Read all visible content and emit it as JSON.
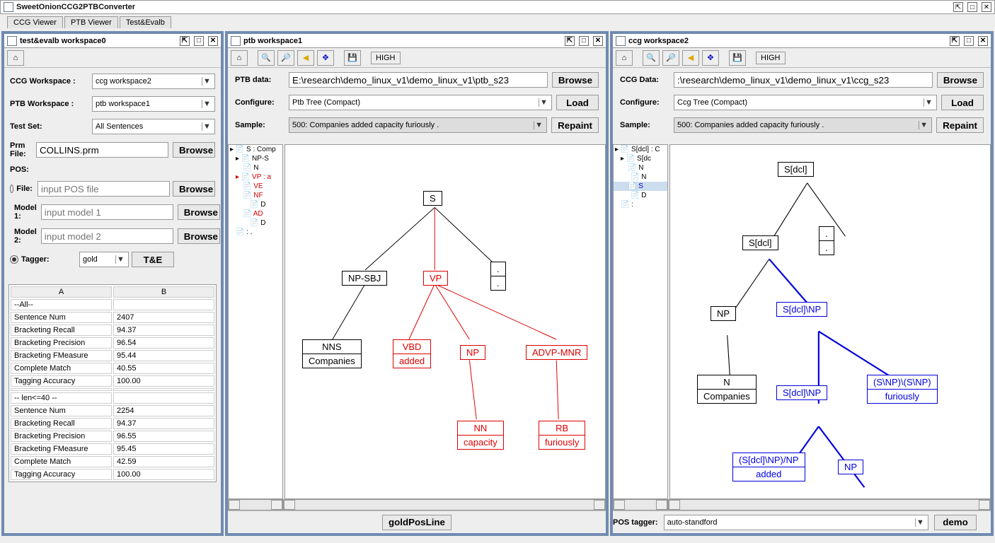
{
  "app": {
    "title": "SweetOnionCCG2PTBConverter",
    "tabs": [
      "CCG Viewer",
      "PTB Viewer",
      "Test&Evalb"
    ]
  },
  "left": {
    "title": "test&evalb workspace0",
    "ccg_ws_label": "CCG Workspace :",
    "ccg_ws_value": "ccg workspace2",
    "ptb_ws_label": "PTB Workspace :",
    "ptb_ws_value": "ptb workspace1",
    "testset_label": "Test Set:",
    "testset_value": "All Sentences",
    "prm_label": "Prm File:",
    "prm_value": "COLLINS.prm",
    "browse": "Browse",
    "pos_label": "POS:",
    "file_label": "File:",
    "file_placeholder": "input POS file",
    "model1_label": "Model 1:",
    "model1_placeholder": "input model 1",
    "model2_label": "Model 2:",
    "model2_placeholder": "input model 2",
    "tagger_label": "Tagger:",
    "tagger_value": "gold",
    "te_btn": "T&E",
    "stats": {
      "hdrA": "A",
      "hdrB": "B",
      "all_rows": [
        [
          "--All--",
          ""
        ],
        [
          "Sentence Num",
          "2407"
        ],
        [
          "Bracketing Recall",
          "94.37"
        ],
        [
          "Bracketing Precision",
          "96.54"
        ],
        [
          "Bracketing FMeasure",
          "95.44"
        ],
        [
          "Complete Match",
          "40.55"
        ],
        [
          "Tagging Accuracy",
          "100.00"
        ],
        [
          "",
          ""
        ],
        [
          "-- len<=40 --",
          ""
        ],
        [
          "Sentence Num",
          "2254"
        ],
        [
          "Bracketing Recall",
          "94.37"
        ],
        [
          "Bracketing Precision",
          "96.55"
        ],
        [
          "Bracketing FMeasure",
          "95.45"
        ],
        [
          "Complete Match",
          "42.59"
        ],
        [
          "Tagging Accuracy",
          "100.00"
        ]
      ]
    }
  },
  "ptb": {
    "title": "ptb workspace1",
    "data_label": "PTB data:",
    "data_value": "E:\\research\\demo_linux_v1\\demo_linux_v1\\ptb_s23",
    "configure_label": "Configure:",
    "configure_value": "Ptb Tree (Compact)",
    "sample_label": "Sample:",
    "sample_value": "500: Companies added capacity furiously .",
    "browse": "Browse",
    "load": "Load",
    "repaint": "Repaint",
    "high": "HIGH",
    "nav": [
      "S : Comp",
      "NP-S",
      "N",
      "VP : a",
      "VE",
      "NF",
      "D",
      "AD",
      "D",
      ": ."
    ],
    "nodes": {
      "S": "S",
      "NPSBJ": "NP-SBJ",
      "VP": "VP",
      "dot": ".",
      "NNS": "NNS",
      "NNS2": "Companies",
      "VBD": "VBD",
      "VBD2": "added",
      "NP": "NP",
      "ADVP": "ADVP-MNR",
      "NN": "NN",
      "NN2": "capacity",
      "RB": "RB",
      "RB2": "furiously"
    },
    "foot": "goldPosLine"
  },
  "ccg": {
    "title": "ccg workspace2",
    "data_label": "CCG Data:",
    "data_value": ":\\research\\demo_linux_v1\\demo_linux_v1\\ccg_s23",
    "configure_label": "Configure:",
    "configure_value": "Ccg Tree (Compact)",
    "sample_label": "Sample:",
    "sample_value": "500: Companies added capacity furiously .",
    "browse": "Browse",
    "load": "Load",
    "repaint": "Repaint",
    "high": "HIGH",
    "nav": [
      "S[dcl] : C",
      "S[dc",
      "N",
      "N",
      "S",
      "D",
      ":"
    ],
    "nodes": {
      "Sdcl": "S[dcl]",
      "Sdcl2": "S[dcl]",
      "dot": ".",
      "NP": "NP",
      "SdclNP": "S[dcl]\\NP",
      "N": "N",
      "N2": "Companies",
      "SdclNP2": "S[dcl]\\NP",
      "SNPSNP": "(S\\NP)\\(S\\NP)",
      "SNPSNP2": "furiously",
      "SdclNPNP": "(S[dcl]\\NP)/NP",
      "SdclNPNP2": "added",
      "NP2": "NP"
    },
    "pos_tagger_label": "POS tagger:",
    "pos_tagger_value": "auto-standford",
    "demo": "demo"
  }
}
